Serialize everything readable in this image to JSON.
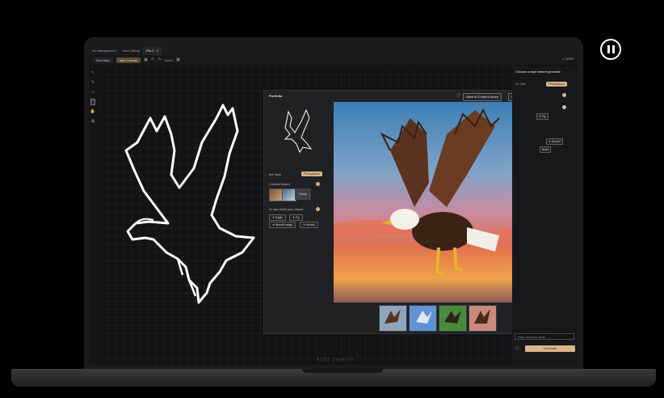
{
  "tabs": [
    {
      "label": "Ink Management"
    },
    {
      "label": "Idea Library"
    },
    {
      "label": "File 1",
      "active": true,
      "close": "×"
    }
  ],
  "toolbar": {
    "modes": [
      "Idea Map",
      "Idea Canvas"
    ],
    "styles_label": "Styles",
    "zoom": "100%"
  },
  "portfolio": {
    "title": "Portfolio",
    "save_content_board": "Save to Content board",
    "save_as": "Save as",
    "art_style_label": "Art Style",
    "art_style_value": "Photography",
    "content_board_label": "Content Board",
    "content_board_none": "None",
    "ai_section_label": "AI can finish your ideas!",
    "chips": [
      "Eagle",
      "Fly",
      "Spread wings",
      "Sunset"
    ],
    "image_overlay": "30%"
  },
  "right_panel": {
    "title": "Choose a style before generate",
    "art_style_label": "Art Style",
    "art_style_value": "Photography",
    "chips": [
      "Fly",
      "Sunset",
      "Birds"
    ],
    "input_placeholder": "Keep mind your ideas",
    "generate": "Generate"
  },
  "colors": {
    "accent": "#d9b78a",
    "background": "#121316"
  }
}
